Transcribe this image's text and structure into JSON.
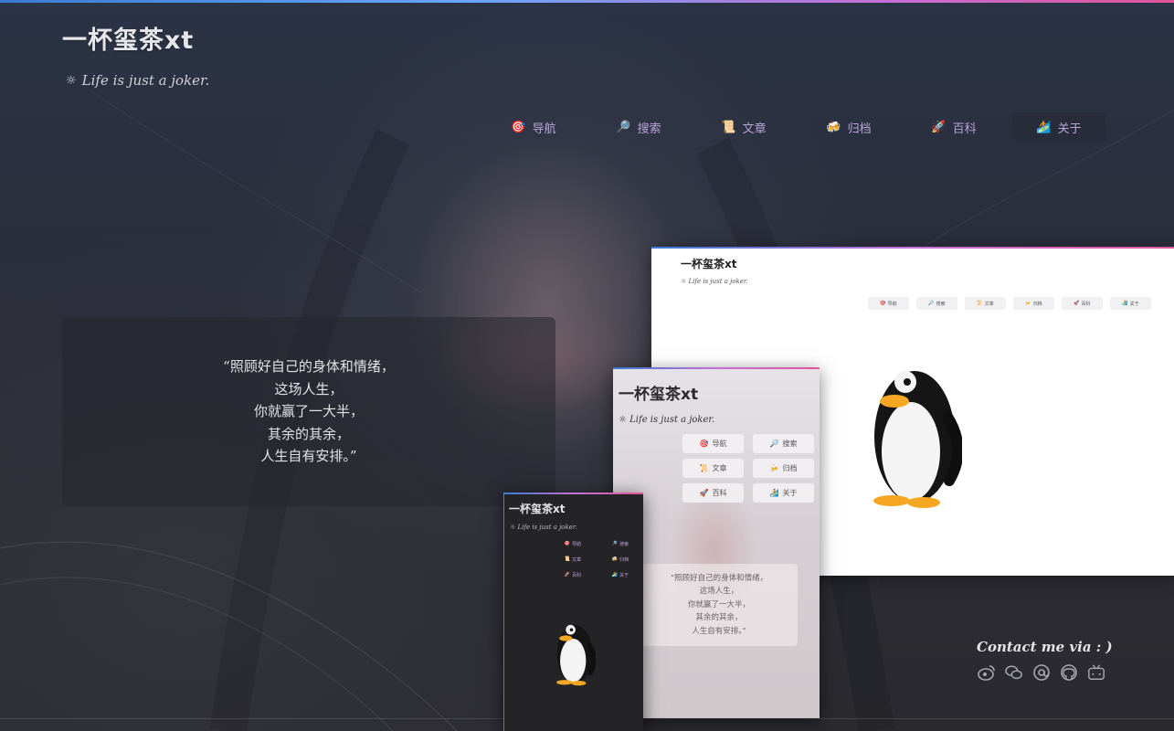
{
  "site": {
    "title": "一杯玺茶xt",
    "tagline": "Life is just a joker."
  },
  "nav": {
    "items": [
      {
        "icon": "🎯",
        "label": "导航",
        "icon_name": "target-icon"
      },
      {
        "icon": "🔎",
        "label": "搜索",
        "icon_name": "magnifier-icon"
      },
      {
        "icon": "📜",
        "label": "文章",
        "icon_name": "scroll-icon"
      },
      {
        "icon": "🍻",
        "label": "归档",
        "icon_name": "archive-icon"
      },
      {
        "icon": "🚀",
        "label": "百科",
        "icon_name": "rocket-icon"
      },
      {
        "icon": "🏄",
        "label": "关于",
        "icon_name": "about-icon"
      }
    ],
    "active_index": 5
  },
  "quote": {
    "lines": [
      "“照顾好自己的身体和情绪，",
      "这场人生，",
      "你就赢了一大半，",
      "其余的其余，",
      "人生自有安排。”"
    ]
  },
  "contact": {
    "title": "Contact me via : )",
    "icons": [
      "weibo-icon",
      "wechat-icon",
      "email-icon",
      "github-icon",
      "bilibili-icon"
    ]
  },
  "colors": {
    "nav_text": "#b9a3d9",
    "accent_gradient": [
      "#3a7bd5",
      "#c46fd6",
      "#e0559b"
    ]
  }
}
